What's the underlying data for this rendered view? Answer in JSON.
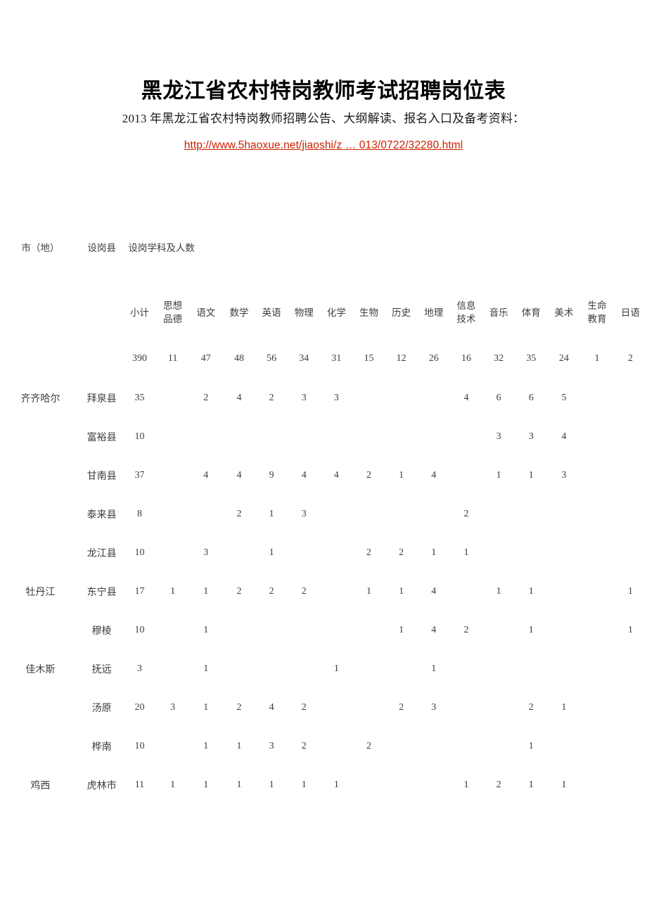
{
  "document": {
    "title": "黑龙江省农村特岗教师考试招聘岗位表",
    "subtitle": "2013 年黑龙江省农村特岗教师招聘公告、大纲解读、报名入口及备考资料：",
    "link_text": "http://www.5haoxue.net/jiaoshi/z … 013/0722/32280.html",
    "link_color": "#cc2200"
  },
  "table": {
    "banner": {
      "city_label": "市（地）",
      "county_label": "设岗县",
      "subjects_label": "设岗学科及人数"
    },
    "columns": [
      {
        "key": "subtotal",
        "label": "小计",
        "lines": [
          "小计"
        ]
      },
      {
        "key": "ideology",
        "label": "思想品德",
        "lines": [
          "思想",
          "",
          "品德"
        ]
      },
      {
        "key": "chinese",
        "label": "语文",
        "lines": [
          "语文"
        ]
      },
      {
        "key": "math",
        "label": "数学",
        "lines": [
          "数学"
        ]
      },
      {
        "key": "english",
        "label": "英语",
        "lines": [
          "英语"
        ]
      },
      {
        "key": "physics",
        "label": "物理",
        "lines": [
          "物理"
        ]
      },
      {
        "key": "chemistry",
        "label": "化学",
        "lines": [
          "化学"
        ]
      },
      {
        "key": "biology",
        "label": "生物",
        "lines": [
          "生物"
        ]
      },
      {
        "key": "history",
        "label": "历史",
        "lines": [
          "历史"
        ]
      },
      {
        "key": "geography",
        "label": "地理",
        "lines": [
          "地理"
        ]
      },
      {
        "key": "infotech",
        "label": "信息技术",
        "lines": [
          "信息",
          "",
          "技术"
        ]
      },
      {
        "key": "music",
        "label": "音乐",
        "lines": [
          "音乐"
        ]
      },
      {
        "key": "pe",
        "label": "体育",
        "lines": [
          "体育"
        ]
      },
      {
        "key": "art",
        "label": "美术",
        "lines": [
          "美术"
        ]
      },
      {
        "key": "lifeedu",
        "label": "生命教育",
        "lines": [
          "生命",
          "",
          "教育"
        ]
      },
      {
        "key": "japanese",
        "label": "日语",
        "lines": [
          "日语"
        ]
      }
    ],
    "totals_row": {
      "city": "",
      "county": "",
      "values": [
        "390",
        "11",
        "47",
        "48",
        "56",
        "34",
        "31",
        "15",
        "12",
        "26",
        "16",
        "32",
        "35",
        "24",
        "1",
        "2"
      ]
    },
    "rows": [
      {
        "city": "齐齐哈尔",
        "county": "拜泉县",
        "values": [
          "35",
          "",
          "2",
          "4",
          "2",
          "3",
          "3",
          "",
          "",
          "",
          "4",
          "6",
          "6",
          "5",
          "",
          ""
        ]
      },
      {
        "city": "",
        "county": "富裕县",
        "values": [
          "10",
          "",
          "",
          "",
          "",
          "",
          "",
          "",
          "",
          "",
          "",
          "3",
          "3",
          "4",
          "",
          ""
        ]
      },
      {
        "city": "",
        "county": "甘南县",
        "values": [
          "37",
          "",
          "4",
          "4",
          "9",
          "4",
          "4",
          "2",
          "1",
          "4",
          "",
          "1",
          "1",
          "3",
          "",
          ""
        ]
      },
      {
        "city": "",
        "county": "泰来县",
        "values": [
          "8",
          "",
          "",
          "2",
          "1",
          "3",
          "",
          "",
          "",
          "",
          "2",
          "",
          "",
          "",
          "",
          ""
        ]
      },
      {
        "city": "",
        "county": "龙江县",
        "values": [
          "10",
          "",
          "3",
          "",
          "1",
          "",
          "",
          "2",
          "2",
          "1",
          "1",
          "",
          "",
          "",
          "",
          ""
        ]
      },
      {
        "city": "牡丹江",
        "county": "东宁县",
        "values": [
          "17",
          "1",
          "1",
          "2",
          "2",
          "2",
          "",
          "1",
          "1",
          "4",
          "",
          "1",
          "1",
          "",
          "",
          "1"
        ]
      },
      {
        "city": "",
        "county": "穆棱",
        "values": [
          "10",
          "",
          "1",
          "",
          "",
          "",
          "",
          "",
          "1",
          "4",
          "2",
          "",
          "1",
          "",
          "",
          "1"
        ]
      },
      {
        "city": "佳木斯",
        "county": "抚远",
        "values": [
          "3",
          "",
          "1",
          "",
          "",
          "",
          "1",
          "",
          "",
          "1",
          "",
          "",
          "",
          "",
          "",
          ""
        ]
      },
      {
        "city": "",
        "county": "汤原",
        "values": [
          "20",
          "3",
          "1",
          "2",
          "4",
          "2",
          "",
          "",
          "2",
          "3",
          "",
          "",
          "2",
          "1",
          "",
          ""
        ]
      },
      {
        "city": "",
        "county": "桦南",
        "values": [
          "10",
          "",
          "1",
          "1",
          "3",
          "2",
          "",
          "2",
          "",
          "",
          "",
          "",
          "1",
          "",
          "",
          ""
        ]
      },
      {
        "city": "鸡西",
        "county": "虎林市",
        "values": [
          "11",
          "1",
          "1",
          "1",
          "1",
          "1",
          "1",
          "",
          "",
          "",
          "1",
          "2",
          "1",
          "1",
          "",
          ""
        ]
      }
    ]
  }
}
